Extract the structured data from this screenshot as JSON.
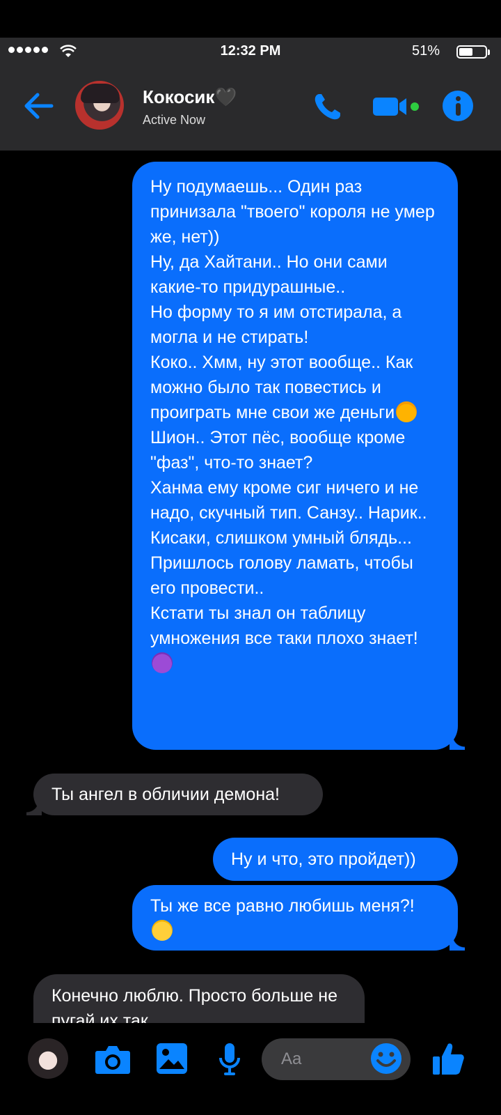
{
  "status_bar": {
    "time": "12:32 PM",
    "battery_percent": "51%",
    "battery_level": 0.51,
    "signal_bars": 5
  },
  "header": {
    "contact_name": "Кокосик🖤",
    "contact_status": "Active Now",
    "icons": [
      "back-arrow-icon",
      "phone-icon",
      "video-icon",
      "info-icon"
    ],
    "accent_color": "#0a84ff"
  },
  "messages": [
    {
      "direction": "outgoing",
      "text": "Ну подумаешь... Один раз принизала \"твоего\" короля не умер же, нет))\nНу, да Хайтани.. Но они сами какие-то придурашные..\nНо форму то я им отстирала, а могла и не стирать!\nКоко.. Хмм, ну этот вообще.. Как можно было так повестись и проиграть мне свои же деньги",
      "text_2": "Шион.. Этот пёс, вообще кроме \"фаз\", что-то знает?\nХанма ему кроме сиг ничего и не надо, скучный тип. Санзу.. Нарик..\nКисаки, слишком умный блядь... Пришлось голову ламать, чтобы его провести..\nКстати ты знал он таблицу умножения все таки плохо знает!",
      "emoji_1": "rolling-laughing-emoji",
      "emoji_2": "smiling-devil-emoji"
    },
    {
      "direction": "incoming",
      "text": "Ты ангел в обличии демона!"
    },
    {
      "direction": "outgoing",
      "text": "Ну и что, это пройдет))"
    },
    {
      "direction": "outgoing",
      "text": "Ты же все равно любишь меня?!",
      "emoji": "pleading-face-emoji"
    },
    {
      "direction": "incoming",
      "text": "Конечно люблю. Просто больше не пугай их так."
    }
  ],
  "composer": {
    "placeholder": "Aa",
    "icons": [
      "camera-icon",
      "image-icon",
      "microphone-icon",
      "smile-icon",
      "thumbs-up-icon"
    ]
  },
  "colors": {
    "outgoing_bubble": "#0a6efc",
    "incoming_bubble": "#2e2d31",
    "bar_background": "#2a2a2c"
  }
}
